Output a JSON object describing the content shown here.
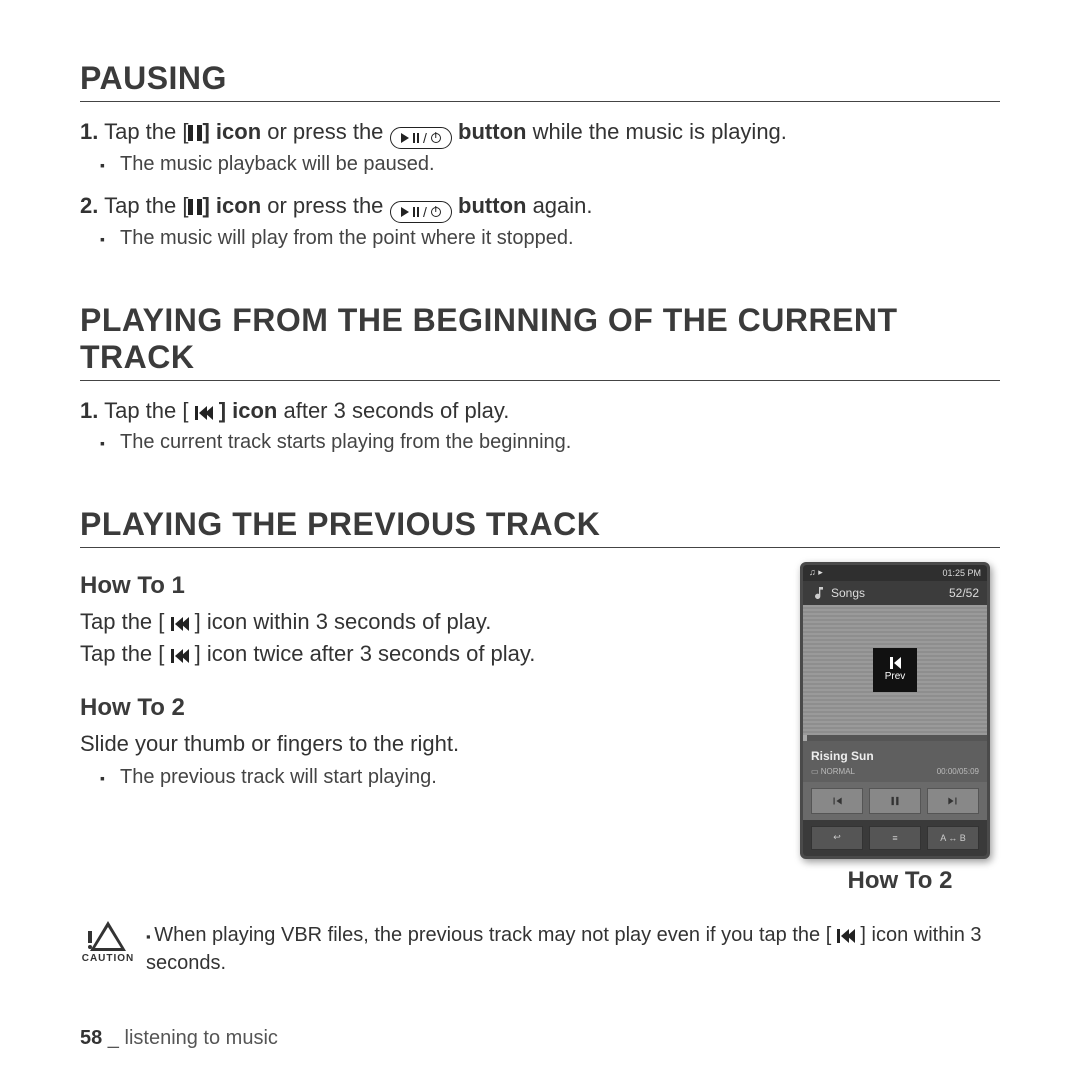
{
  "sections": {
    "pausing": {
      "title": "PAUSING",
      "step1_a": "1.",
      "step1_b": "Tap the [",
      "step1_c": "] icon",
      "step1_d": " or press the ",
      "step1_e": " button",
      "step1_f": " while the music is playing.",
      "sub1": "The music playback will be paused.",
      "step2_a": "2.",
      "step2_b": "Tap the [",
      "step2_c": "] icon",
      "step2_d": " or press the ",
      "step2_e": " button",
      "step2_f": " again.",
      "sub2": "The music will play from the point where it stopped."
    },
    "beginning": {
      "title": "PLAYING FROM THE BEGINNING OF THE CURRENT TRACK",
      "step1_a": "1.",
      "step1_b": "Tap the [ ",
      "step1_c": " ] icon",
      "step1_d": " after 3 seconds of play.",
      "sub1": "The current track starts playing from the beginning."
    },
    "previous": {
      "title": "PLAYING THE PREVIOUS TRACK",
      "howto1": "How To 1",
      "h1_l1_a": "Tap the [ ",
      "h1_l1_b": " ] icon",
      "h1_l1_c": " within 3 seconds of play.",
      "h1_l2_a": "Tap the [ ",
      "h1_l2_b": " ] icon",
      "h1_l2_c": " twice after 3 seconds of play.",
      "howto2": "How To 2",
      "h2_l1": "Slide your thumb or fingers to the right.",
      "h2_sub": "The previous track will start playing."
    }
  },
  "device": {
    "time": "01:25 PM",
    "header": "Songs",
    "count": "52/52",
    "prev_label": "Prev",
    "track": "Rising Sun",
    "mode": "NORMAL",
    "elapsed": "00:00/05:09",
    "ab": "A ↔ B",
    "caption": "How To 2"
  },
  "caution": {
    "label": "CAUTION",
    "text_a": "When playing VBR files, the previous track may not play even if you tap the ",
    "text_b": "[ ",
    "text_c": " ] icon",
    "text_d": " within 3 seconds."
  },
  "footer": {
    "page": "58",
    "sep": " _ ",
    "chapter": "listening to music"
  }
}
